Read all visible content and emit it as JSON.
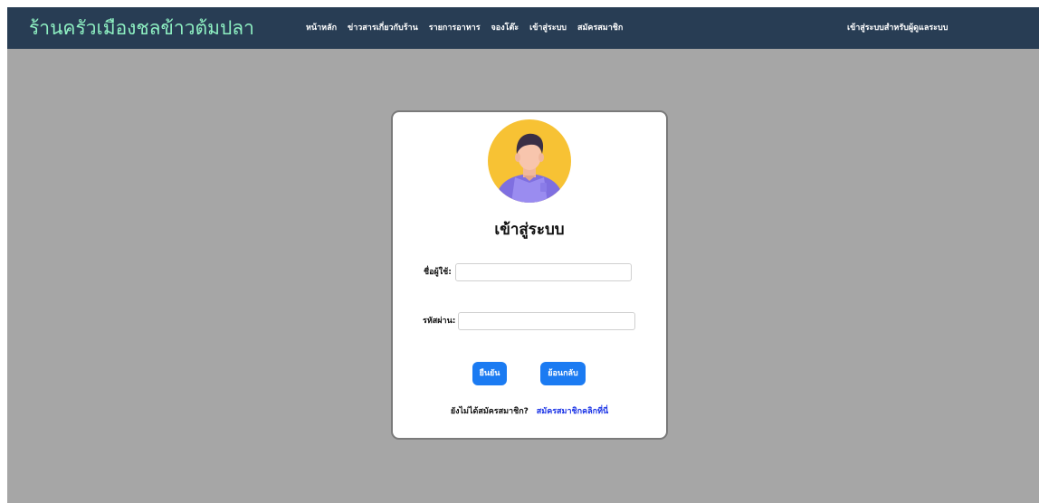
{
  "navbar": {
    "brand": "ร้านครัวเมืองชลข้าวต้มปลา",
    "links": [
      {
        "label": "หน้าหลัก"
      },
      {
        "label": "ข่าวสารเกี่ยวกับร้าน"
      },
      {
        "label": "รายการอาหาร"
      },
      {
        "label": "จองโต๊ะ"
      },
      {
        "label": "เข้าสู่ระบบ"
      },
      {
        "label": "สมัครสมาชิก"
      }
    ],
    "admin_link": "เข้าสู่ระบบสำหรับผู้ดูแลระบบ"
  },
  "login": {
    "title": "เข้าสู่ระบบ",
    "username_label": "ชื่อผู้ใช้:",
    "username_value": "",
    "password_label": "รหัสผ่าน:",
    "password_value": "",
    "confirm_button": "ยืนยัน",
    "back_button": "ย้อนกลับ",
    "register_prompt": "ยังไม่ได้สมัครสมาชิก?",
    "register_link": "สมัครสมาชิกคลิกที่นี่"
  },
  "colors": {
    "navbar_bg": "#283d54",
    "brand_text": "#8ef0c2",
    "page_bg": "#a6a6a6",
    "button_bg": "#1b7bf2",
    "link_color": "#1a33e6"
  },
  "icons": {
    "avatar": "user-avatar-icon"
  }
}
